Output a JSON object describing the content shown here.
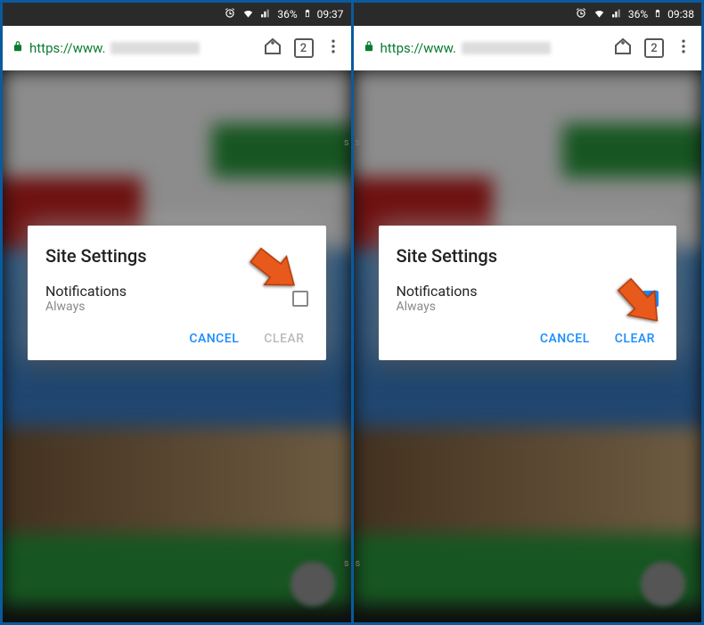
{
  "panes": [
    {
      "status": {
        "battery": "36%",
        "time": "09:37"
      },
      "url": {
        "prefix": "https://www."
      },
      "dialog": {
        "title": "Site Settings",
        "notif_label": "Notifications",
        "notif_sub": "Always",
        "checked": false,
        "cancel": "CANCEL",
        "clear": "CLEAR",
        "clear_enabled": false,
        "arrow_target": "checkbox"
      },
      "tab_count": "2"
    },
    {
      "status": {
        "battery": "36%",
        "time": "09:38"
      },
      "url": {
        "prefix": "https://www."
      },
      "dialog": {
        "title": "Site Settings",
        "notif_label": "Notifications",
        "notif_sub": "Always",
        "checked": true,
        "cancel": "CANCEL",
        "clear": "CLEAR",
        "clear_enabled": true,
        "arrow_target": "clear"
      },
      "tab_count": "2"
    }
  ]
}
